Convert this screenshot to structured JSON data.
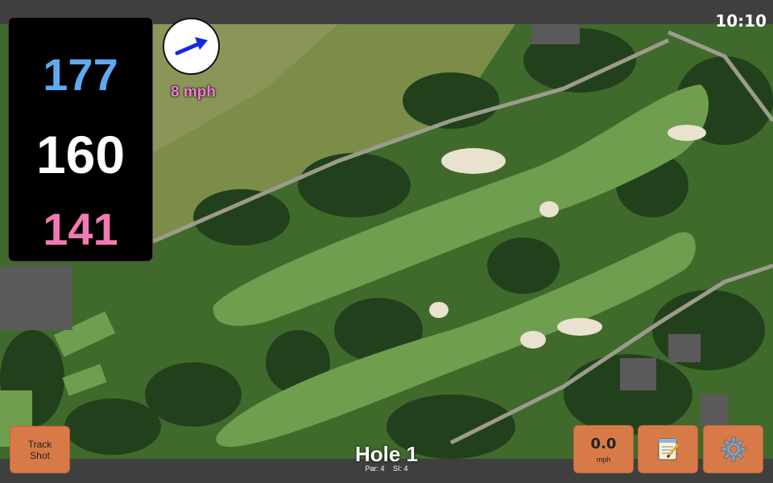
{
  "status_bar": {
    "time": "10:10"
  },
  "distances": {
    "back": "177",
    "middle": "160",
    "front": "141"
  },
  "wind": {
    "speed_label": "8 mph",
    "direction_icon": "arrow-icon"
  },
  "buttons": {
    "track_shot_line1": "Track",
    "track_shot_line2": "Shot",
    "speed_value": "0.0",
    "speed_unit": "mph",
    "notes_icon": "notepad-icon",
    "settings_icon": "gear-icon"
  },
  "hole": {
    "title": "Hole 1",
    "par": "Par: 4",
    "si": "SI: 4"
  },
  "colors": {
    "back": "#5fa9f0",
    "middle": "#ffffff",
    "front": "#f07ab3",
    "wind_text": "#f47fd2",
    "button": "#d87a47"
  }
}
